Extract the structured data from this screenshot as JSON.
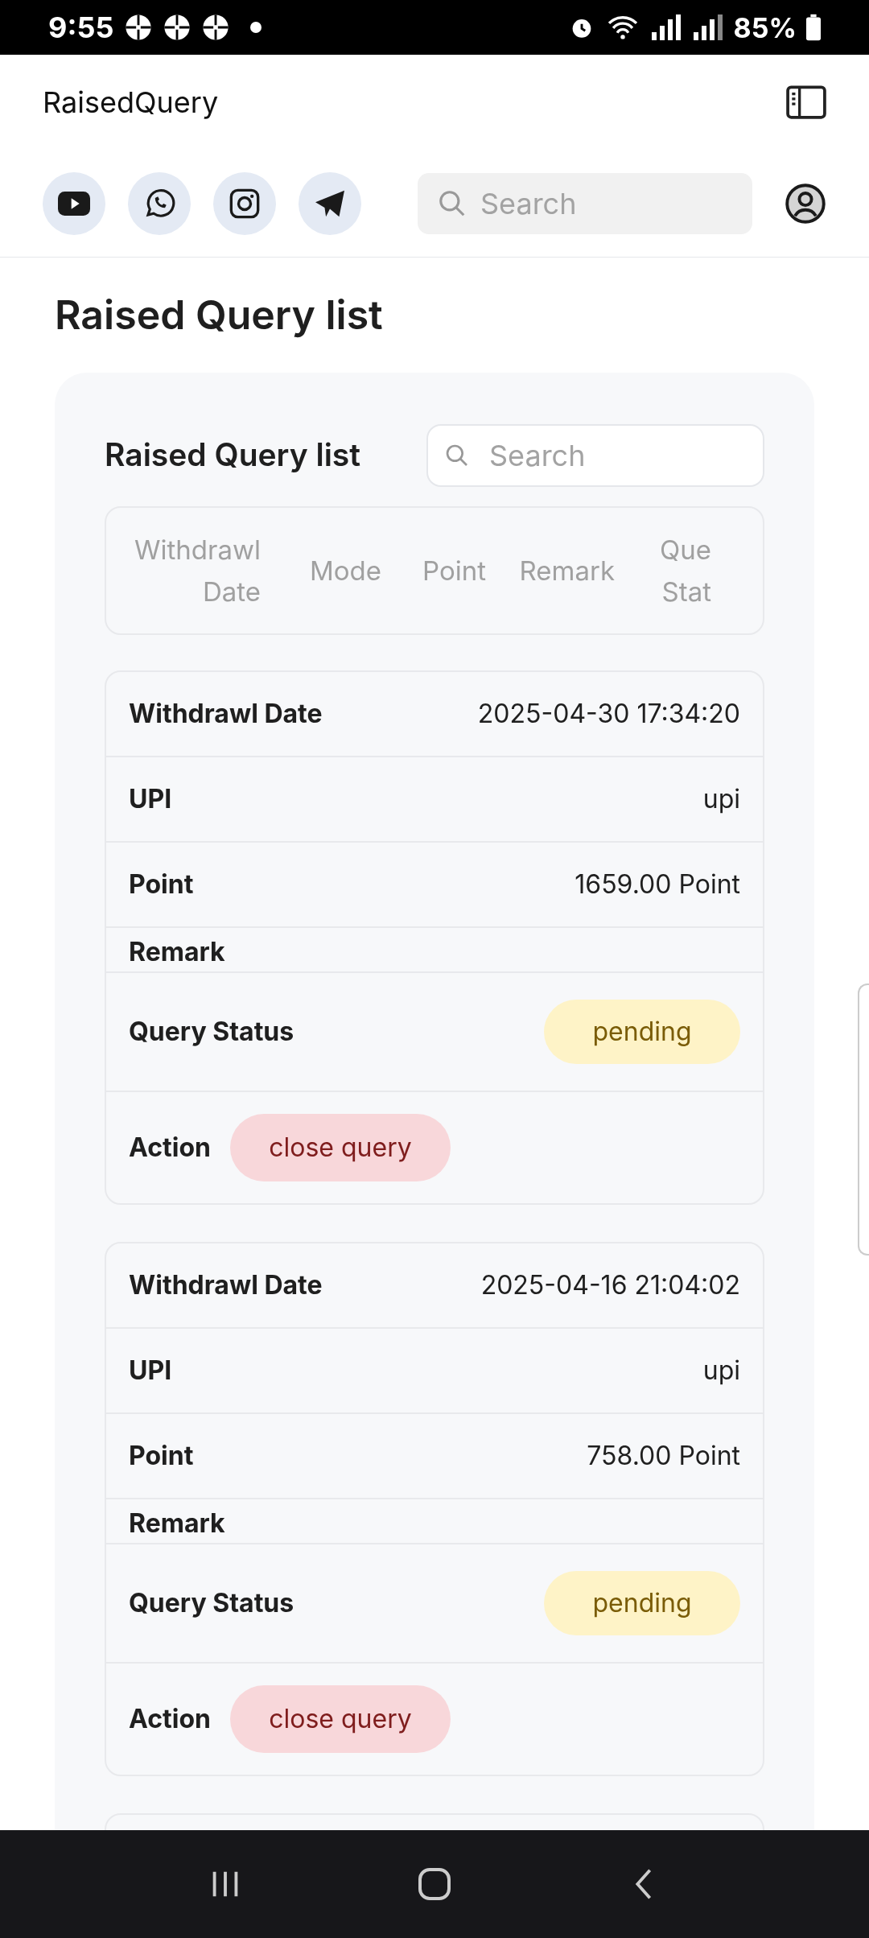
{
  "status_bar": {
    "time": "9:55",
    "battery": "85%"
  },
  "header": {
    "title": "RaisedQuery"
  },
  "toolbar": {
    "search": {
      "placeholder": "Search"
    }
  },
  "page_title": "Raised Query list",
  "panel": {
    "title": "Raised Query list",
    "search": {
      "placeholder": "Search"
    },
    "table": {
      "columns": [
        [
          "Withdrawl",
          "Date"
        ],
        [
          "Mode"
        ],
        [
          "Point"
        ],
        [
          "Remark"
        ],
        [
          "Que",
          "Stat"
        ]
      ]
    },
    "records": [
      {
        "rows": [
          {
            "kind": "text",
            "label": "Withdrawl Date",
            "value": "2025-04-30 17:34:20"
          },
          {
            "kind": "text",
            "label": "UPI",
            "value": "upi"
          },
          {
            "kind": "text",
            "label": "Point",
            "value": "1659.00 Point"
          },
          {
            "kind": "empty",
            "label": "Remark"
          },
          {
            "kind": "status",
            "label": "Query Status",
            "value": "pending"
          },
          {
            "kind": "action",
            "label": "Action",
            "value": "close query"
          }
        ]
      },
      {
        "rows": [
          {
            "kind": "text",
            "label": "Withdrawl Date",
            "value": "2025-04-16 21:04:02"
          },
          {
            "kind": "text",
            "label": "UPI",
            "value": "upi"
          },
          {
            "kind": "text",
            "label": "Point",
            "value": "758.00 Point"
          },
          {
            "kind": "empty",
            "label": "Remark"
          },
          {
            "kind": "status",
            "label": "Query Status",
            "value": "pending"
          },
          {
            "kind": "action",
            "label": "Action",
            "value": "close query"
          }
        ]
      }
    ]
  }
}
